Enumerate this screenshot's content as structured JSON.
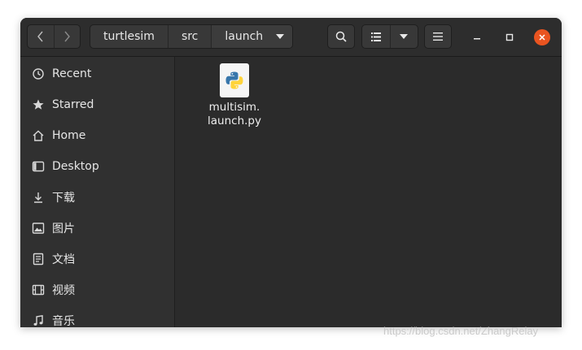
{
  "window": {
    "path": [
      "turtlesim",
      "src",
      "launch"
    ]
  },
  "sidebar": {
    "items": [
      {
        "label": "Recent",
        "icon": "clock-icon"
      },
      {
        "label": "Starred",
        "icon": "star-icon"
      },
      {
        "label": "Home",
        "icon": "home-icon"
      },
      {
        "label": "Desktop",
        "icon": "desktop-icon"
      },
      {
        "label": "下载",
        "icon": "download-icon"
      },
      {
        "label": "图片",
        "icon": "pictures-icon"
      },
      {
        "label": "文档",
        "icon": "documents-icon"
      },
      {
        "label": "视频",
        "icon": "videos-icon"
      },
      {
        "label": "音乐",
        "icon": "music-icon"
      }
    ]
  },
  "files": [
    {
      "name_line1": "multisim.",
      "name_line2": "launch.py",
      "icon": "python-file-icon"
    }
  ],
  "watermark": "https://blog.csdn.net/ZhangRelay",
  "colors": {
    "close": "#e95420",
    "window_bg": "#2b2b2b",
    "sidebar_bg": "#303030"
  }
}
